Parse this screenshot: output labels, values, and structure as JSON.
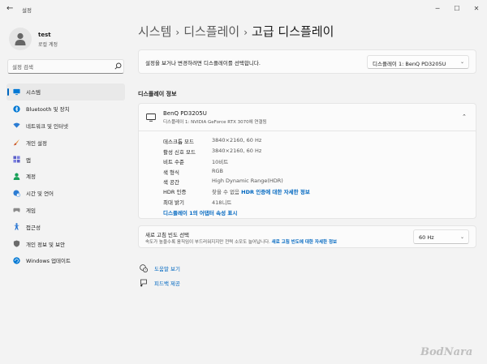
{
  "window": {
    "title": "설정",
    "back": "←",
    "minimize": "─",
    "maximize": "☐",
    "close": "✕"
  },
  "user": {
    "name": "test",
    "account_type": "로컬 계정"
  },
  "search": {
    "placeholder": "설정 검색"
  },
  "sidebar": {
    "items": [
      {
        "label": "시스템",
        "icon": "monitor-icon",
        "color": "#0078d4",
        "active": true
      },
      {
        "label": "Bluetooth 및 장치",
        "icon": "bluetooth-icon",
        "color": "#0078d4"
      },
      {
        "label": "네트워크 및 인터넷",
        "icon": "wifi-icon",
        "color": "#2b7cd3"
      },
      {
        "label": "개인 설정",
        "icon": "brush-icon",
        "color": "#e3872b"
      },
      {
        "label": "앱",
        "icon": "apps-icon",
        "color": "#5b5fc7"
      },
      {
        "label": "계정",
        "icon": "person-icon",
        "color": "#18a058"
      },
      {
        "label": "시간 및 언어",
        "icon": "globe-clock-icon",
        "color": "#2b7cd3"
      },
      {
        "label": "게임",
        "icon": "gamepad-icon",
        "color": "#8a8a8a"
      },
      {
        "label": "접근성",
        "icon": "accessibility-icon",
        "color": "#1f6fd0"
      },
      {
        "label": "개인 정보 및 보안",
        "icon": "shield-icon",
        "color": "#6b6b6b"
      },
      {
        "label": "Windows 업데이트",
        "icon": "update-icon",
        "color": "#0078d4"
      }
    ]
  },
  "breadcrumb": {
    "items": [
      "시스템",
      "디스플레이",
      "고급 디스플레이"
    ],
    "separator": "›"
  },
  "display_select": {
    "description": "설정을 보거나 변경하려면 디스플레이를 선택합니다.",
    "value": "디스플레이 1: BenQ PD3205U",
    "chevron": "⌄"
  },
  "display_info": {
    "section_title": "디스플레이 정보",
    "monitor_name": "BenQ PD3205U",
    "monitor_sub": "디스플레이 1: NVIDIA GeForce RTX 3070에 연결됨",
    "chevron": "⌃",
    "specs": [
      {
        "key": "데스크톱 모드",
        "value": "3840×2160, 60 Hz"
      },
      {
        "key": "활성 신호 모드",
        "value": "3840×2160, 60 Hz"
      },
      {
        "key": "비트 수준",
        "value": "10비트"
      },
      {
        "key": "색 형식",
        "value": "RGB"
      },
      {
        "key": "색 공간",
        "value": "High Dynamic Range(HDR)"
      },
      {
        "key": "HDR 인증",
        "value": "찾을 수 없음",
        "link": "HDR 인증에 대한 자세한 정보"
      },
      {
        "key": "최대 밝기",
        "value": "418니트"
      }
    ],
    "adapter_link": "디스플레이 1의 어댑터 속성 표시"
  },
  "refresh_rate": {
    "title": "새로 고침 빈도 선택",
    "description": "속도가 높을수록 움직임이 부드러워지지만 전력 소모도 늘어납니다.",
    "link": "새로 고침 빈도에 대한 자세한 정보",
    "value": "60 Hz",
    "chevron": "⌄"
  },
  "footer_links": {
    "help": "도움말 보기",
    "feedback": "피드백 제공"
  },
  "watermark": "BodNara"
}
